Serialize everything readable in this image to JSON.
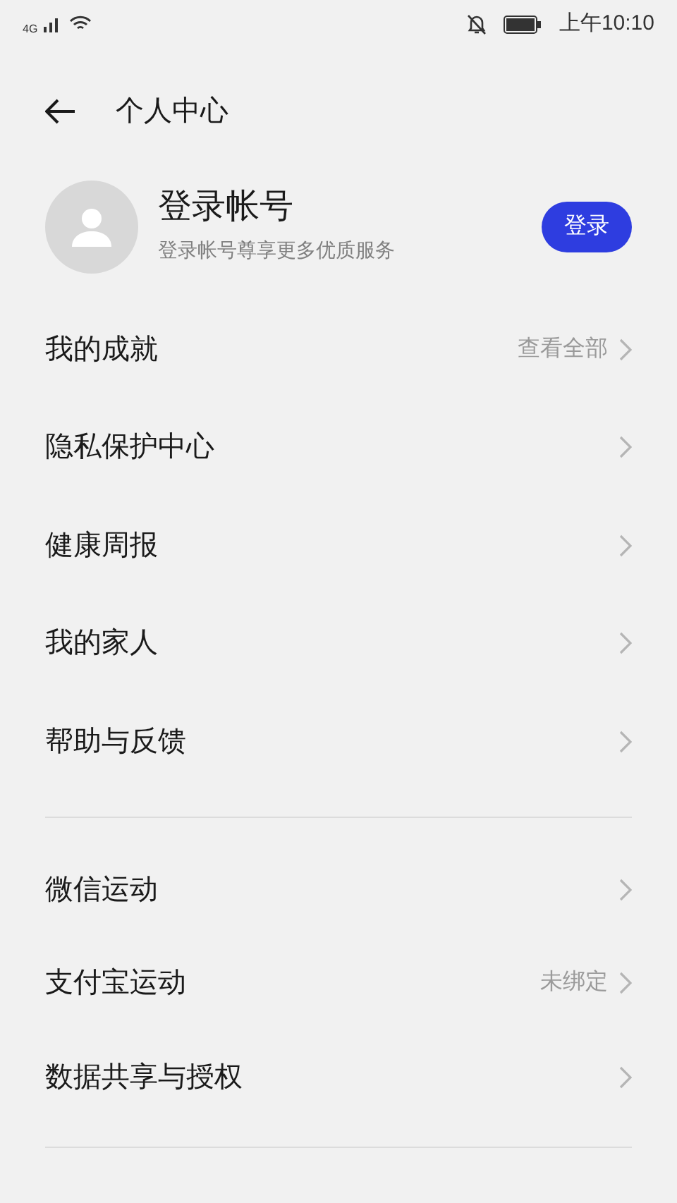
{
  "status_bar": {
    "network": "4G",
    "time": "上午10:10"
  },
  "header": {
    "title": "个人中心"
  },
  "account": {
    "name": "登录帐号",
    "subtitle": "登录帐号尊享更多优质服务",
    "button": "登录"
  },
  "sections": [
    {
      "items": [
        {
          "label": "我的成就",
          "value": "查看全部"
        },
        {
          "label": "隐私保护中心"
        },
        {
          "label": "健康周报"
        },
        {
          "label": "我的家人"
        },
        {
          "label": "帮助与反馈"
        }
      ]
    },
    {
      "items": [
        {
          "label": "微信运动"
        },
        {
          "label": "支付宝运动",
          "value": "未绑定"
        },
        {
          "label": "数据共享与授权"
        }
      ]
    }
  ]
}
